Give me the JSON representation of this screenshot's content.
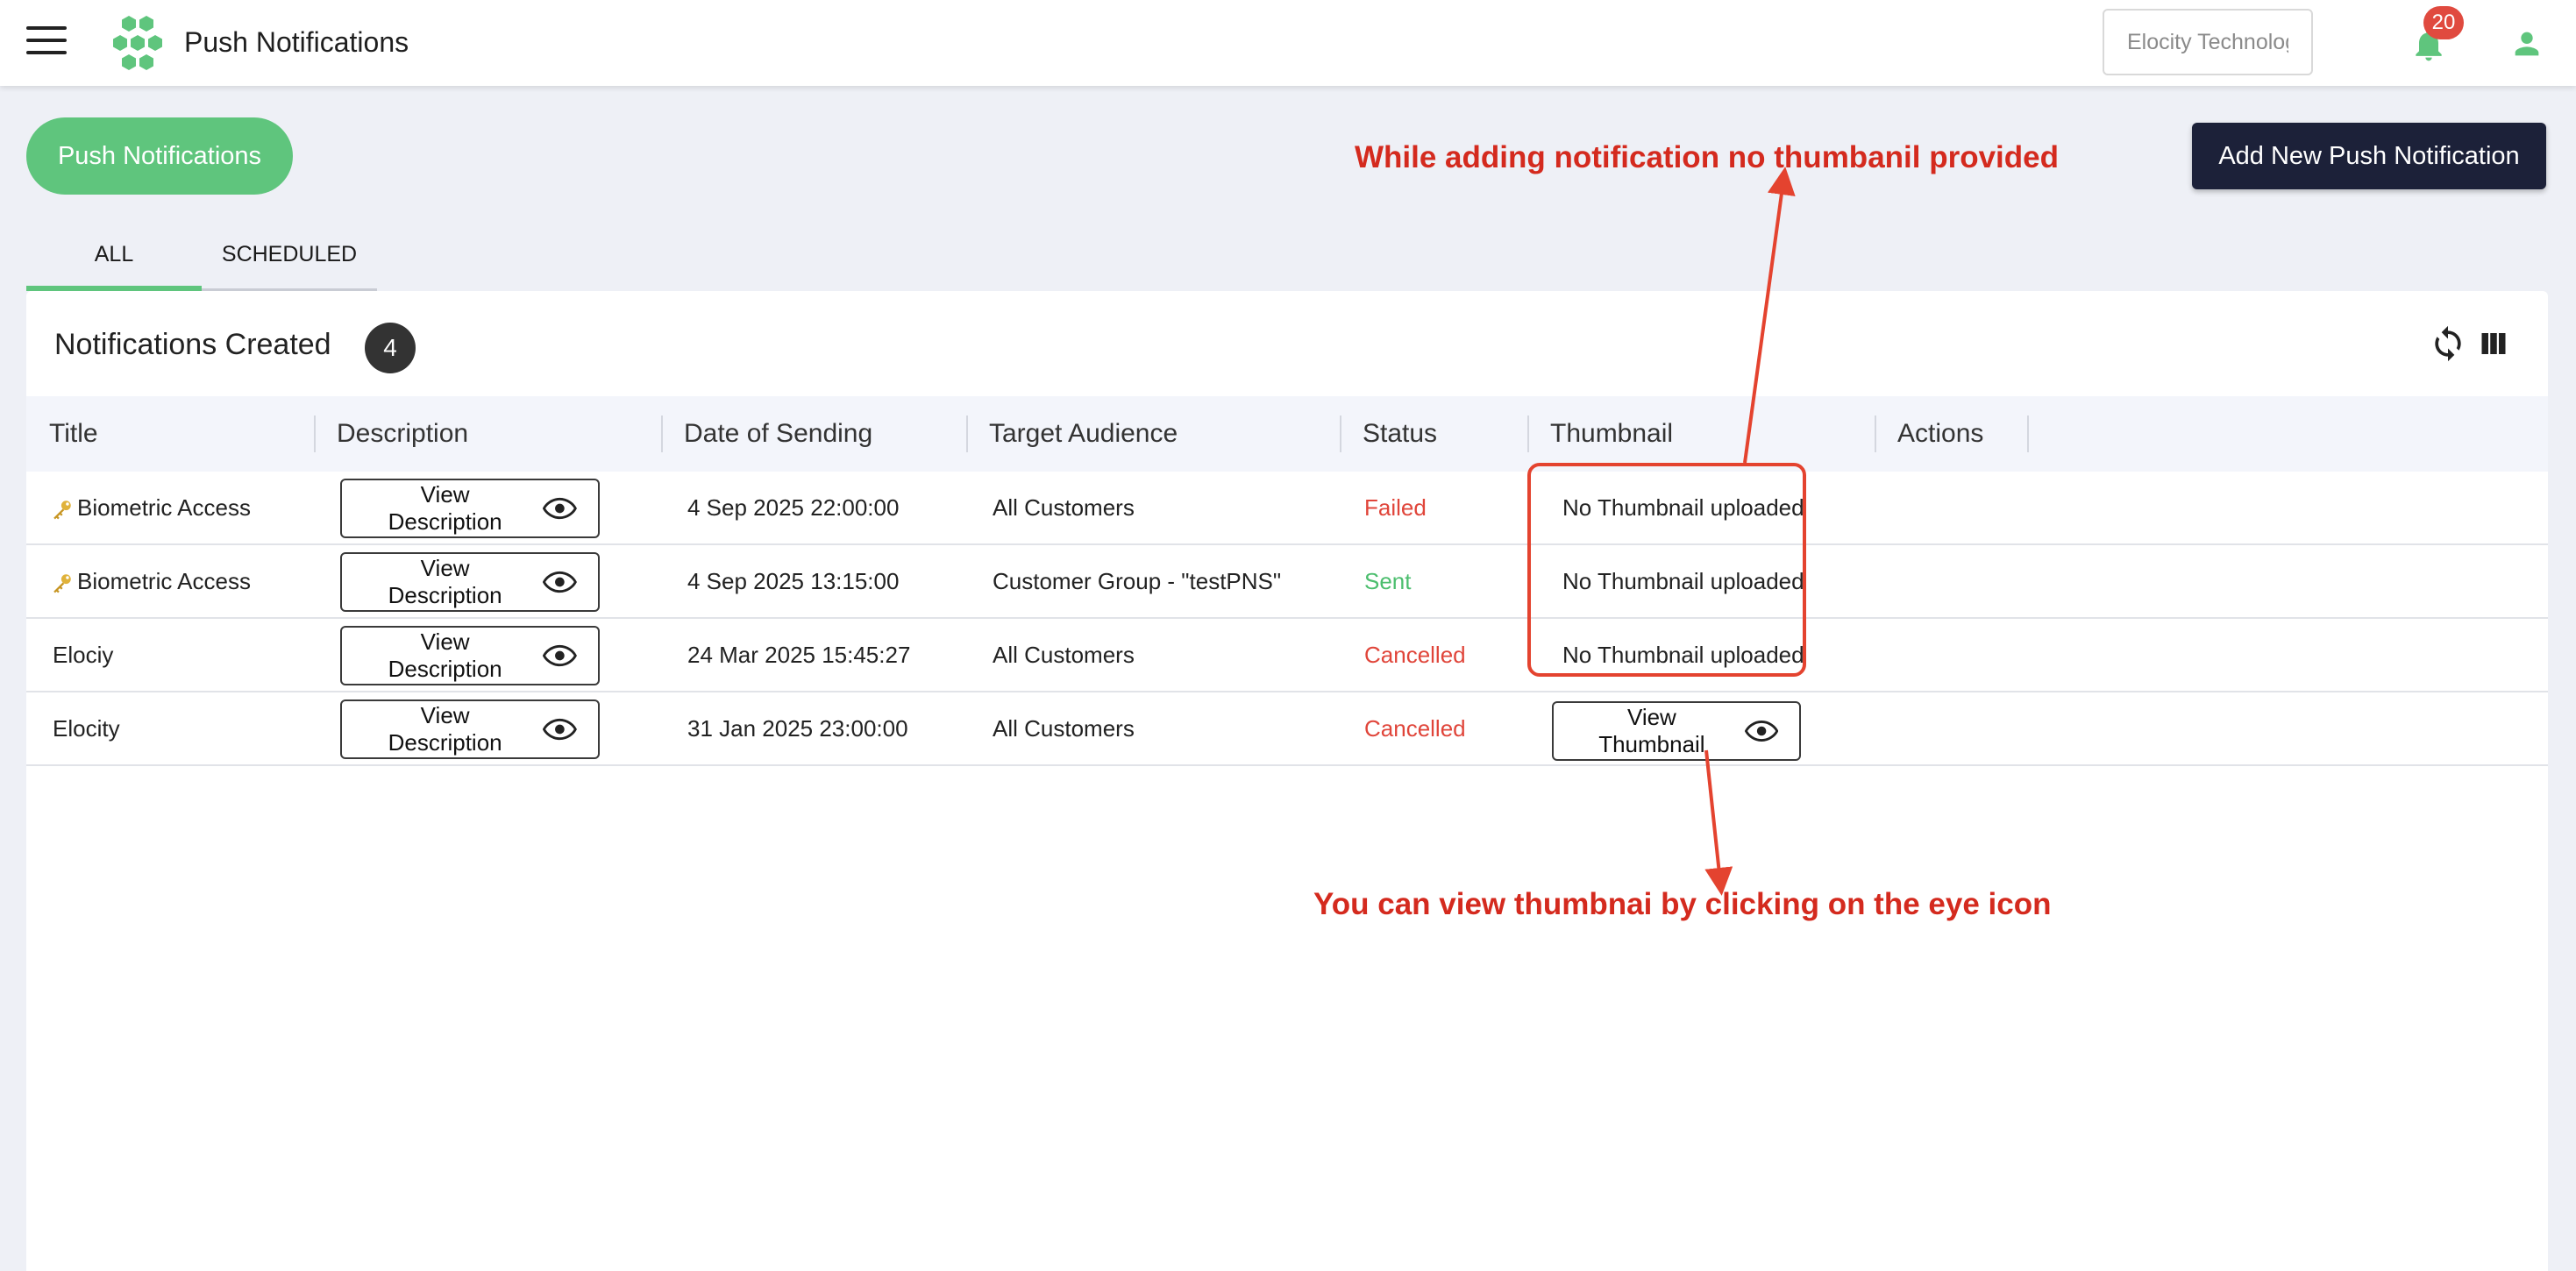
{
  "appbar": {
    "title": "Push Notifications",
    "org_input_value": "Elocity Technologies I",
    "notification_count": "20"
  },
  "header": {
    "pill_label": "Push Notifications",
    "add_button_label": "Add New Push Notification"
  },
  "tabs": [
    {
      "label": "ALL",
      "active": true
    },
    {
      "label": "SCHEDULED",
      "active": false
    }
  ],
  "card": {
    "title": "Notifications Created",
    "count": "4"
  },
  "columns": [
    "Title",
    "Description",
    "Date of Sending",
    "Target Audience",
    "Status",
    "Thumbnail",
    "Actions"
  ],
  "rows": [
    {
      "title": "Biometric Access",
      "has_key_icon": true,
      "description_button": "View Description",
      "date": "4 Sep 2025 22:00:00",
      "audience": "All Customers",
      "status": "Failed",
      "thumbnail": "No Thumbnail uploaded"
    },
    {
      "title": "Biometric Access",
      "has_key_icon": true,
      "description_button": "View Description",
      "date": "4 Sep 2025 13:15:00",
      "audience": "Customer Group - \"testPNS\"",
      "status": "Sent",
      "thumbnail": "No Thumbnail uploaded"
    },
    {
      "title": "Elociy",
      "has_key_icon": false,
      "description_button": "View Description",
      "date": "24 Mar 2025 15:45:27",
      "audience": "All Customers",
      "status": "Cancelled",
      "thumbnail": "No Thumbnail uploaded"
    },
    {
      "title": "Elocity",
      "has_key_icon": false,
      "description_button": "View Description",
      "date": "31 Jan 2025 23:00:00",
      "audience": "All Customers",
      "status": "Cancelled",
      "thumbnail_button": "View Thumbnail"
    }
  ],
  "annotations": {
    "top": "While adding notification no thumbanil provided",
    "bottom": "You can view thumbnai by clicking on the eye icon"
  },
  "colors": {
    "accent_green": "#5fc57d",
    "navy_button": "#1c2139",
    "status_failed": "#e0453a",
    "status_sent": "#4cbe6e",
    "annotation_red": "#d42a1e"
  },
  "icons": [
    "menu-icon",
    "logo-icon",
    "bell-icon",
    "user-icon",
    "refresh-icon",
    "columns-icon",
    "key-icon",
    "eye-icon"
  ]
}
